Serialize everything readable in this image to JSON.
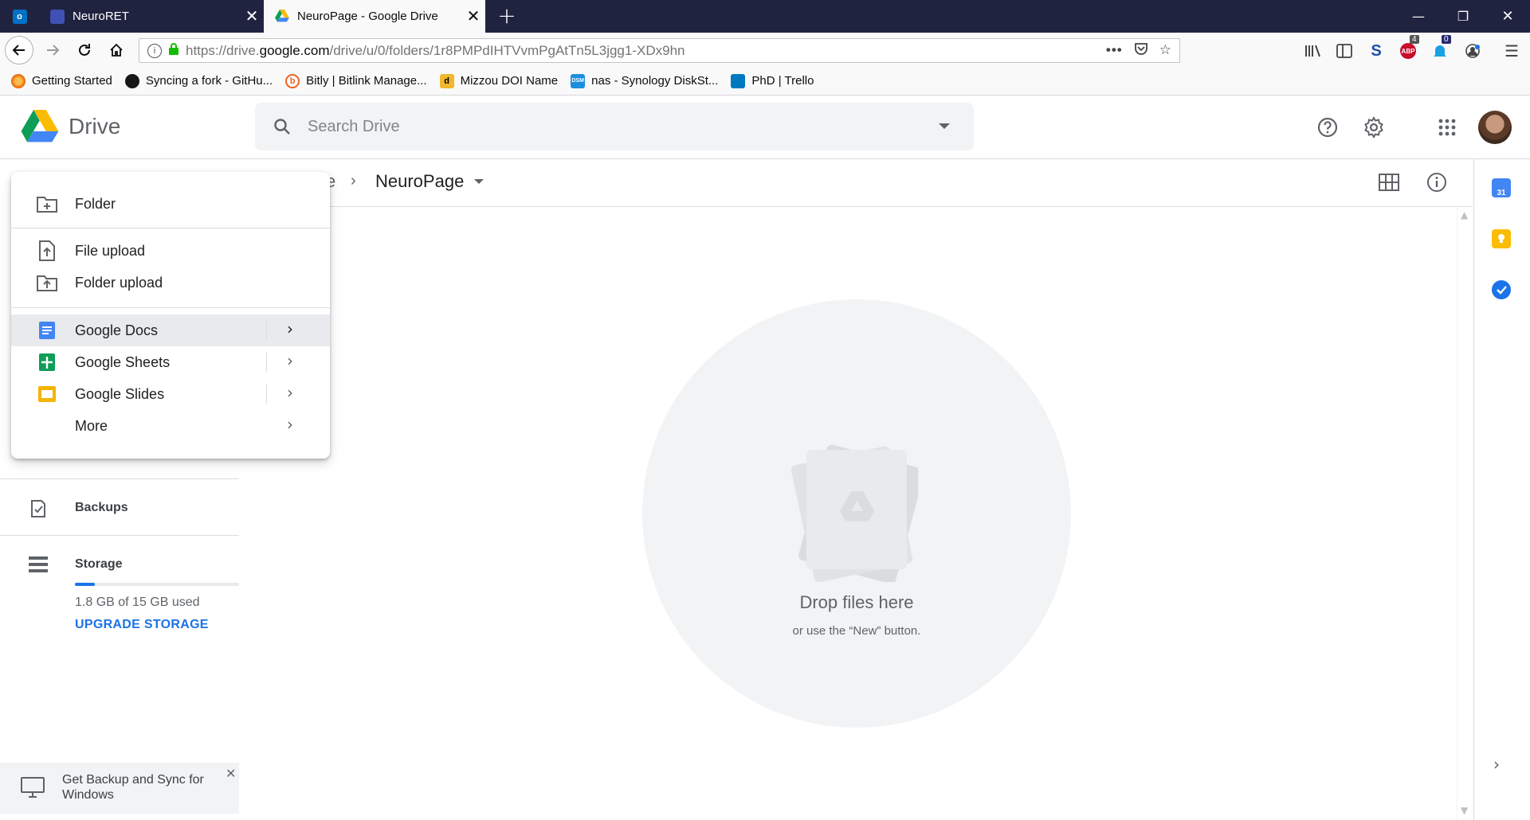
{
  "browser": {
    "tabs": [
      {
        "title": "NeuroRET"
      },
      {
        "title": "NeuroPage - Google Drive"
      }
    ],
    "new_tab_symbol": "+",
    "close_symbol": "✕",
    "url": {
      "prefix": "https://drive.",
      "domain": "google.com",
      "path": "/drive/u/0/folders/1r8PMPdIHTVvmPgAtTn5L3jgg1-XDx9hn"
    },
    "bookmarks": [
      {
        "label": "Getting Started"
      },
      {
        "label": "Syncing a fork - GitHu..."
      },
      {
        "label": "Bitly | Bitlink Manage..."
      },
      {
        "label": "Mizzou DOI Name"
      },
      {
        "label": "nas - Synology DiskSt..."
      },
      {
        "label": "PhD | Trello"
      }
    ],
    "badges": {
      "abp": "4",
      "notif": "0"
    }
  },
  "drive": {
    "logo_text": "Drive",
    "search_placeholder": "Search Drive",
    "breadcrumb": {
      "partial": "e",
      "separator": "›",
      "current": "NeuroPage"
    },
    "new_menu": {
      "folder": "Folder",
      "file_upload": "File upload",
      "folder_upload": "Folder upload",
      "google_docs": "Google Docs",
      "google_sheets": "Google Sheets",
      "google_slides": "Google Slides",
      "more": "More"
    },
    "sidebar": {
      "backups": "Backups",
      "storage": "Storage",
      "storage_used": "1.8 GB of 15 GB used",
      "storage_fraction": 0.12,
      "upgrade": "UPGRADE STORAGE",
      "backup_promo": "Get Backup and Sync for Windows"
    },
    "empty_state": {
      "title": "Drop files here",
      "subtitle": "or use the “New” button."
    },
    "calendar_day": "31"
  },
  "colors": {
    "browser_chrome": "#202340",
    "accent_blue": "#1a73e8",
    "docs_blue": "#4285f4",
    "sheets_green": "#0f9d58",
    "slides_yellow": "#f4b400"
  }
}
